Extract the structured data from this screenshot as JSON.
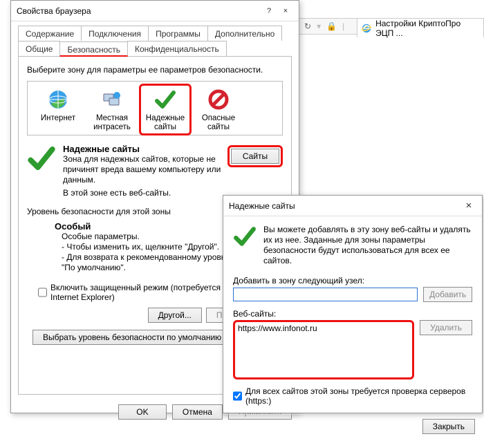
{
  "browser": {
    "tab_title": "Настройки КриптоПро ЭЦП ...",
    "icons": {
      "refresh": "refresh-icon",
      "lock": "lock-icon",
      "ie": "ie-icon"
    }
  },
  "props_window": {
    "title": "Свойства браузера",
    "help": "?",
    "close": "×",
    "tabs_row1": [
      "Содержание",
      "Подключения",
      "Программы",
      "Дополнительно"
    ],
    "tabs_row2": [
      "Общие",
      "Безопасность",
      "Конфиденциальность"
    ],
    "active_tab": "Безопасность",
    "zone_prompt": "Выберите зону для параметры ее параметров безопасности.",
    "zones": [
      {
        "label": "Интернет"
      },
      {
        "label": "Местная интрасеть"
      },
      {
        "label": "Надежные сайты"
      },
      {
        "label": "Опасные сайты"
      }
    ],
    "trusted": {
      "header": "Надежные сайты",
      "desc1": "Зона для надежных сайтов, которые не причинят вреда вашему компьютеру или данным.",
      "desc2": "В этой зоне есть веб-сайты.",
      "sites_btn": "Сайты"
    },
    "sec_level_label": "Уровень безопасности для этой зоны",
    "special": {
      "title": "Особый",
      "l1": "Особые параметры.",
      "l2": "- Чтобы изменить их, щелкните \"Другой\".",
      "l3": "- Для возврата к рекомендованному уровню щелкните",
      "l4": "\"По умолчанию\"."
    },
    "protected_mode": "Включить защищенный режим (потребуется перезапуск Internet Explorer)",
    "btn_other": "Другой...",
    "btn_default": "По умолчанию",
    "btn_reset": "Выбрать уровень безопасности по умолчанию для всех зон",
    "ok": "OK",
    "cancel": "Отмена",
    "apply": "Применить"
  },
  "trusted_dialog": {
    "title": "Надежные сайты",
    "close": "×",
    "intro": "Вы можете добавлять в эту зону веб-сайты и удалять их из нее. Заданные для зоны параметры безопасности будут использоваться для всех ее сайтов.",
    "add_label": "Добавить в зону следующий узел:",
    "add_btn": "Добавить",
    "list_label": "Веб-сайты:",
    "list_item": "https://www.infonot.ru",
    "del_btn": "Удалить",
    "https_check": "Для всех сайтов этой зоны требуется проверка серверов (https:)",
    "close_btn": "Закрыть"
  }
}
